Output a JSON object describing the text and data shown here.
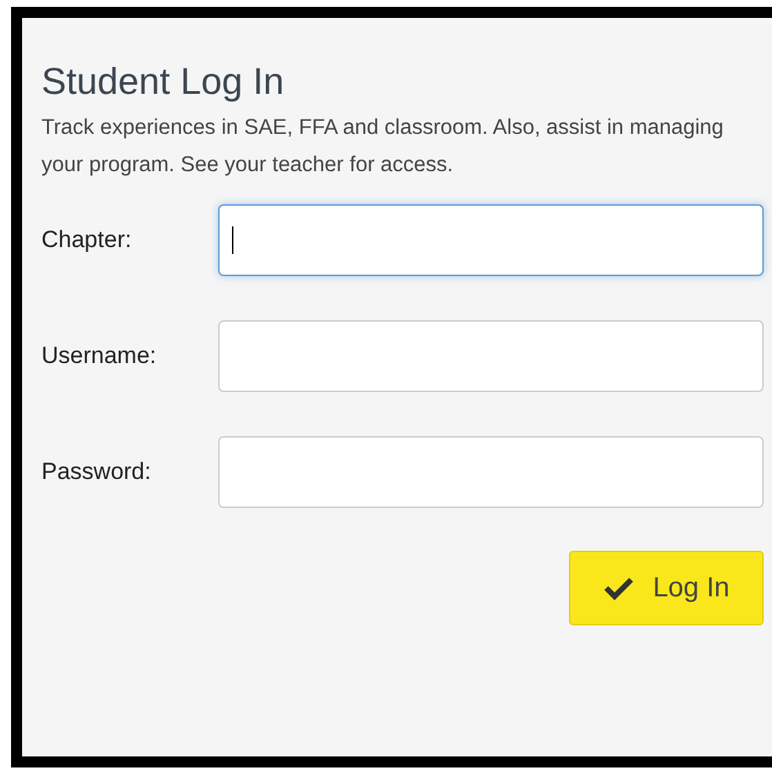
{
  "title": "Student Log In",
  "description": "Track experiences in SAE, FFA and classroom. Also, assist in managing your program. See your teacher for access.",
  "fields": [
    {
      "label": "Chapter:",
      "focused": true
    },
    {
      "label": "Username:",
      "focused": false
    },
    {
      "label": "Password:",
      "focused": false
    }
  ],
  "submit_button": {
    "label": "Log In"
  }
}
